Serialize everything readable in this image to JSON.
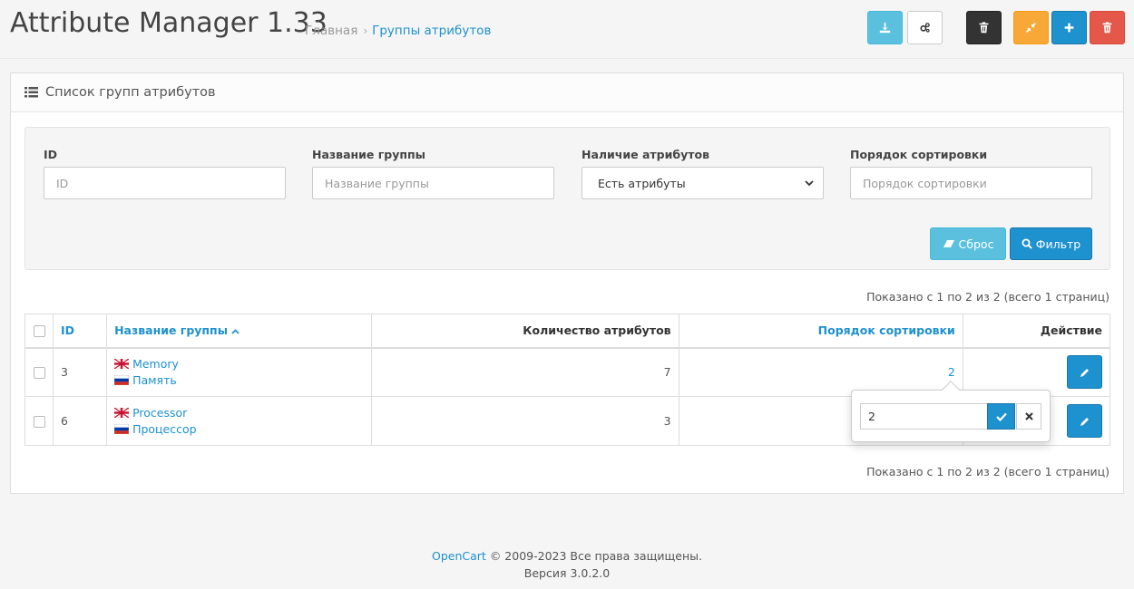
{
  "header": {
    "title": "Attribute Manager 1.33",
    "breadcrumb": {
      "home": "Главная",
      "separator": "›",
      "current": "Группы атрибутов"
    },
    "buttons": [
      {
        "name": "download",
        "icon": "download-icon",
        "color": "#5bc0de"
      },
      {
        "name": "settings",
        "icon": "cogs-icon",
        "color": "#ffffff"
      },
      {
        "name": "delete-all",
        "icon": "trash-icon",
        "color": "#333333"
      },
      {
        "name": "merge",
        "icon": "compress-icon",
        "color": "#f7a837"
      },
      {
        "name": "add",
        "icon": "plus-icon",
        "color": "#1e91cf"
      },
      {
        "name": "delete",
        "icon": "trash-icon",
        "color": "#e4584a"
      }
    ]
  },
  "panel": {
    "title": "Список групп атрибутов",
    "filter": {
      "id_label": "ID",
      "id_placeholder": "ID",
      "name_label": "Название группы",
      "name_placeholder": "Название группы",
      "has_attr_label": "Наличие атрибутов",
      "has_attr_value": "Есть атрибуты",
      "sort_label": "Порядок сортировки",
      "sort_placeholder": "Порядок сортировки",
      "reset_label": "Сброс",
      "filter_label": "Фильтр"
    },
    "results_text": "Показано с 1 по 2 из 2 (всего 1 страниц)",
    "table": {
      "columns": {
        "id": "ID",
        "name": "Название группы",
        "count": "Количество атрибутов",
        "sort": "Порядок сортировки",
        "action": "Действие"
      },
      "rows": [
        {
          "id": "3",
          "name_en": "Memory",
          "name_ru": "Память",
          "count": "7",
          "sort": "2"
        },
        {
          "id": "6",
          "name_en": "Processor",
          "name_ru": "Процессор",
          "count": "3",
          "sort": ""
        }
      ]
    },
    "popover": {
      "value": "2"
    }
  },
  "footer": {
    "brand": "OpenCart",
    "copyright": "© 2009-2023 Все права защищены.",
    "version": "Версия 3.0.2.0"
  },
  "colors": {
    "primary": "#1e91cf",
    "info": "#5bc0de",
    "warning": "#f7a837",
    "danger": "#e4584a",
    "dark": "#333333"
  }
}
